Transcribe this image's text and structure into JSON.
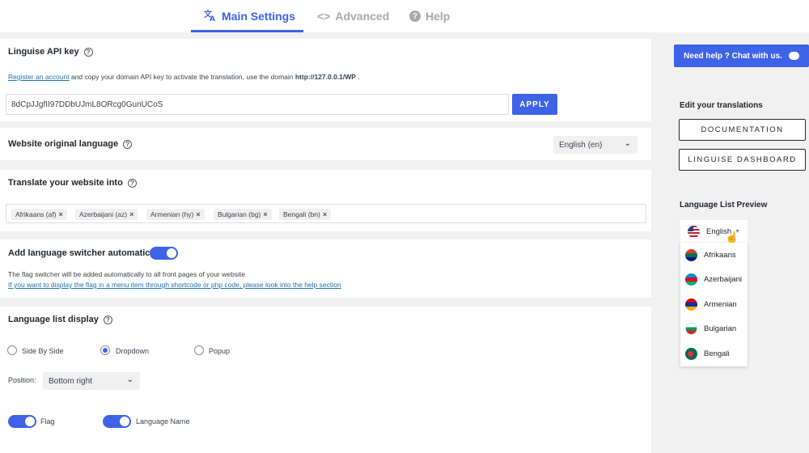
{
  "tabs": [
    {
      "label": "Main Settings",
      "icon": "translate-icon"
    },
    {
      "label": "Advanced",
      "icon": "code-icon"
    },
    {
      "label": "Help",
      "icon": "question-icon"
    }
  ],
  "api": {
    "title": "Linguise API key",
    "register_link": "Register an account",
    "description_rest": " and copy your domain API key to activate the translation, use the domain ",
    "domain": "http://127.0.0.1/WP",
    "period": " .",
    "key_value": "8dCpJJgfII97DDbUJmL8ORcg0GunUCoS",
    "apply_label": "APPLY"
  },
  "original_language": {
    "title": "Website original language",
    "selected": "English (en)"
  },
  "translate_into": {
    "title": "Translate your website into",
    "tags": [
      "Afrikaans (af)",
      "Azerbaijani (az)",
      "Armenian (hy)",
      "Bulgarian (bg)",
      "Bengali (bn)"
    ]
  },
  "switcher": {
    "title": "Add language switcher automatically",
    "enabled": true,
    "note": "The flag switcher will be added automatically to all front pages of your website",
    "link": "If you want to display the flag in a menu item through shortcode or php code, please look into the help section"
  },
  "display": {
    "title": "Language list display",
    "options": [
      "Side By Side",
      "Dropdown",
      "Popup"
    ],
    "selected": "Dropdown",
    "position_label": "Position:",
    "position_value": "Bottom right",
    "flag_label": "Flag",
    "name_label": "Language Name"
  },
  "sidebar": {
    "chat_label": "Need help ? Chat with us.",
    "edit_title": "Edit your translations",
    "doc_label": "DOCUMENTATION",
    "dashboard_label": "LINGUISE DASHBOARD",
    "preview_title": "Language List Preview",
    "preview_current": "English",
    "preview_languages": [
      "Afrikaans",
      "Azerbaijani",
      "Armenian",
      "Bulgarian",
      "Bengali"
    ]
  },
  "colors": {
    "accent": "#3f63e6",
    "page_bg": "#f1f1f1"
  }
}
